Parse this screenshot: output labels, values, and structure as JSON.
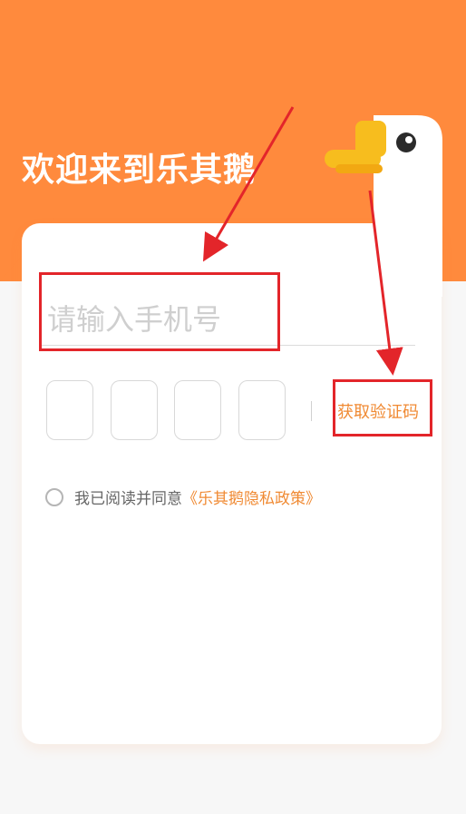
{
  "header": {
    "welcome": "欢迎来到乐其鹅",
    "bg_color": "#ff8a3d"
  },
  "mascot": {
    "icon": "goose-mascot-icon"
  },
  "login": {
    "phone_placeholder": "请输入手机号",
    "phone_value": "",
    "code_boxes": [
      "",
      "",
      "",
      ""
    ],
    "get_code_label": "获取验证码",
    "agree_text": "我已阅读并同意",
    "policy_link": "《乐其鹅隐私政策》",
    "accent_color": "#f08a33"
  },
  "annotations": {
    "highlight_color": "#e3252a"
  }
}
